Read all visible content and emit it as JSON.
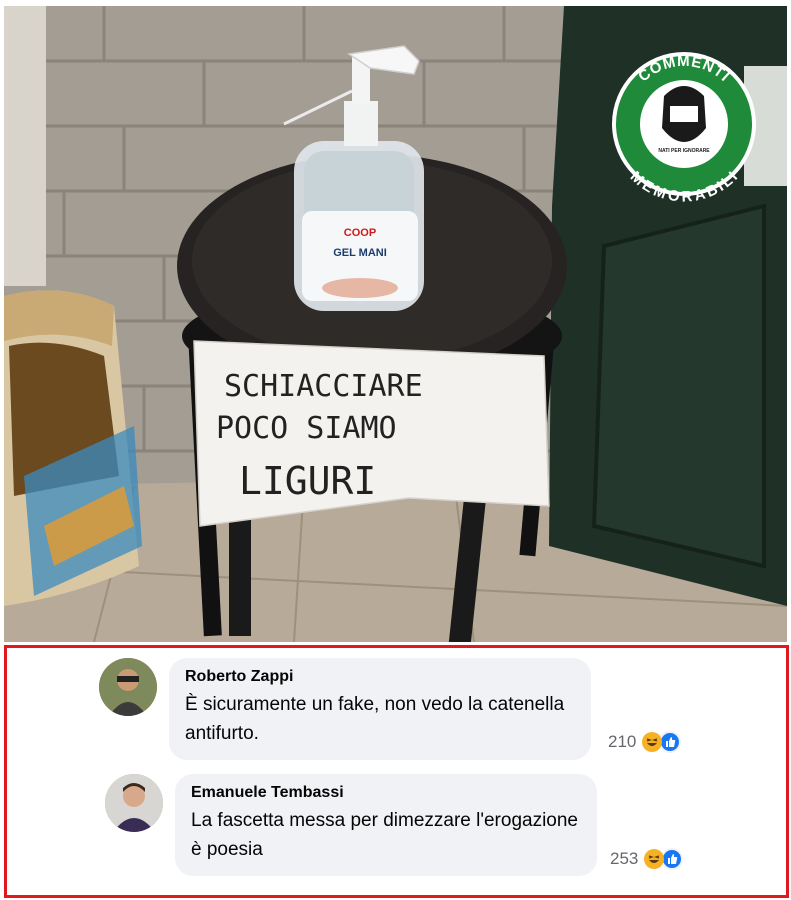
{
  "photo": {
    "note_lines": [
      "SCHIACCIARE",
      "POCO  SIAMO",
      "LIGURI"
    ],
    "bottle_brand": "COOP",
    "bottle_label": "GEL MANI",
    "badge": {
      "top_text": "COMMENTI",
      "bottom_text": "MEMORABILI",
      "inner_text": "NATI PER IGNORARE",
      "color": "#1e8a3a"
    }
  },
  "comments": [
    {
      "author": "Roberto Zappi",
      "text": "È sicuramente un fake, non vedo la catenella antifurto.",
      "reaction_count": "210",
      "reactions": [
        "haha-icon",
        "like-icon"
      ]
    },
    {
      "author": "Emanuele Tembassi",
      "text": "La fascetta messa per dimezzare l'erogazione è poesia",
      "reaction_count": "253",
      "reactions": [
        "haha-icon",
        "like-icon"
      ]
    }
  ],
  "colors": {
    "highlight_border": "#e0191f",
    "bubble_bg": "#f0f2f5",
    "like_blue": "#1877f2",
    "haha_yellow": "#f7b125"
  }
}
